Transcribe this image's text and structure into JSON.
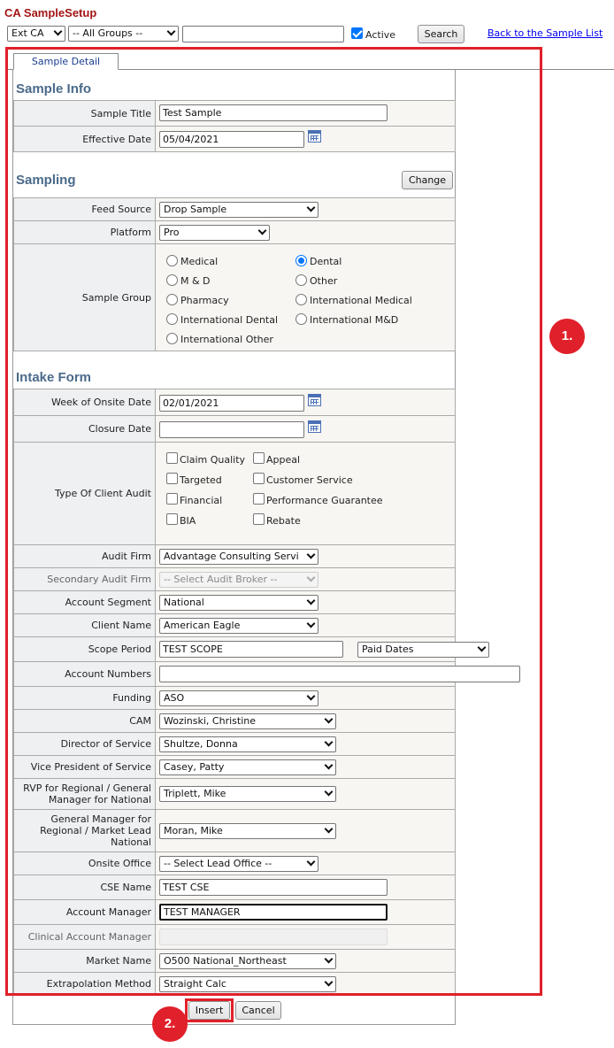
{
  "header": {
    "title": "CA SampleSetup",
    "ext_select": "Ext CA",
    "groups_select": "-- All Groups --",
    "search_value": "",
    "active_label": "Active",
    "active_checked": true,
    "search_button": "Search",
    "back_link": "Back to the Sample List"
  },
  "tab": {
    "label": "Sample Detail"
  },
  "sample_info": {
    "heading": "Sample Info",
    "title_label": "Sample Title",
    "title_value": "Test Sample",
    "date_label": "Effective Date",
    "date_value": "05/04/2021"
  },
  "sampling": {
    "heading": "Sampling",
    "change_button": "Change",
    "feed_label": "Feed Source",
    "feed_value": "Drop Sample",
    "platform_label": "Platform",
    "platform_value": "Pro",
    "group_label": "Sample Group",
    "groups": [
      "Medical",
      "Dental",
      "M & D",
      "Other",
      "Pharmacy",
      "International Medical",
      "International Dental",
      "International M&D",
      "International Other"
    ],
    "selected_group": "Dental"
  },
  "intake": {
    "heading": "Intake Form",
    "week_label": "Week of Onsite Date",
    "week_value": "02/01/2021",
    "closure_label": "Closure Date",
    "closure_value": "",
    "audit_type_label": "Type Of Client Audit",
    "audit_types": [
      "Claim Quality",
      "Appeal",
      "Targeted",
      "Customer Service",
      "Financial",
      "Performance Guarantee",
      "BIA",
      "Rebate"
    ],
    "audit_firm_label": "Audit Firm",
    "audit_firm_value": "Advantage Consulting Servi",
    "secondary_firm_label": "Secondary Audit Firm",
    "secondary_firm_value": "-- Select Audit Broker --",
    "segment_label": "Account Segment",
    "segment_value": "National",
    "client_label": "Client Name",
    "client_value": "American Eagle",
    "scope_label": "Scope Period",
    "scope_value": "TEST SCOPE",
    "scope_type": "Paid Dates",
    "account_numbers_label": "Account Numbers",
    "account_numbers_value": "",
    "funding_label": "Funding",
    "funding_value": "ASO",
    "cam_label": "CAM",
    "cam_value": "Wozinski, Christine",
    "director_label": "Director of Service",
    "director_value": "Shultze, Donna",
    "vp_label": "Vice President of Service",
    "vp_value": "Casey, Patty",
    "rvp_label_1": "RVP for Regional / General",
    "rvp_label_2": "Manager for National",
    "rvp_value": "Triplett, Mike",
    "gm_label_1": "General Manager for",
    "gm_label_2": "Regional / Market Lead",
    "gm_label_3": "National",
    "gm_value": "Moran, Mike",
    "onsite_label": "Onsite Office",
    "onsite_value": "-- Select Lead Office --",
    "cse_label": "CSE Name",
    "cse_value": "TEST CSE",
    "acct_mgr_label": "Account Manager",
    "acct_mgr_value": "TEST MANAGER",
    "clinical_label": "Clinical Account Manager",
    "clinical_value": "",
    "market_label": "Market Name",
    "market_value": "O500 National_Northeast",
    "extrap_label": "Extrapolation Method",
    "extrap_value": "Straight Calc"
  },
  "actions": {
    "insert": "Insert",
    "cancel": "Cancel"
  },
  "callouts": {
    "one": "1.",
    "two": "2."
  },
  "colors": {
    "accent_red": "#e0202a",
    "section_heading": "#4a6a8a",
    "title_red": "#a31515"
  }
}
